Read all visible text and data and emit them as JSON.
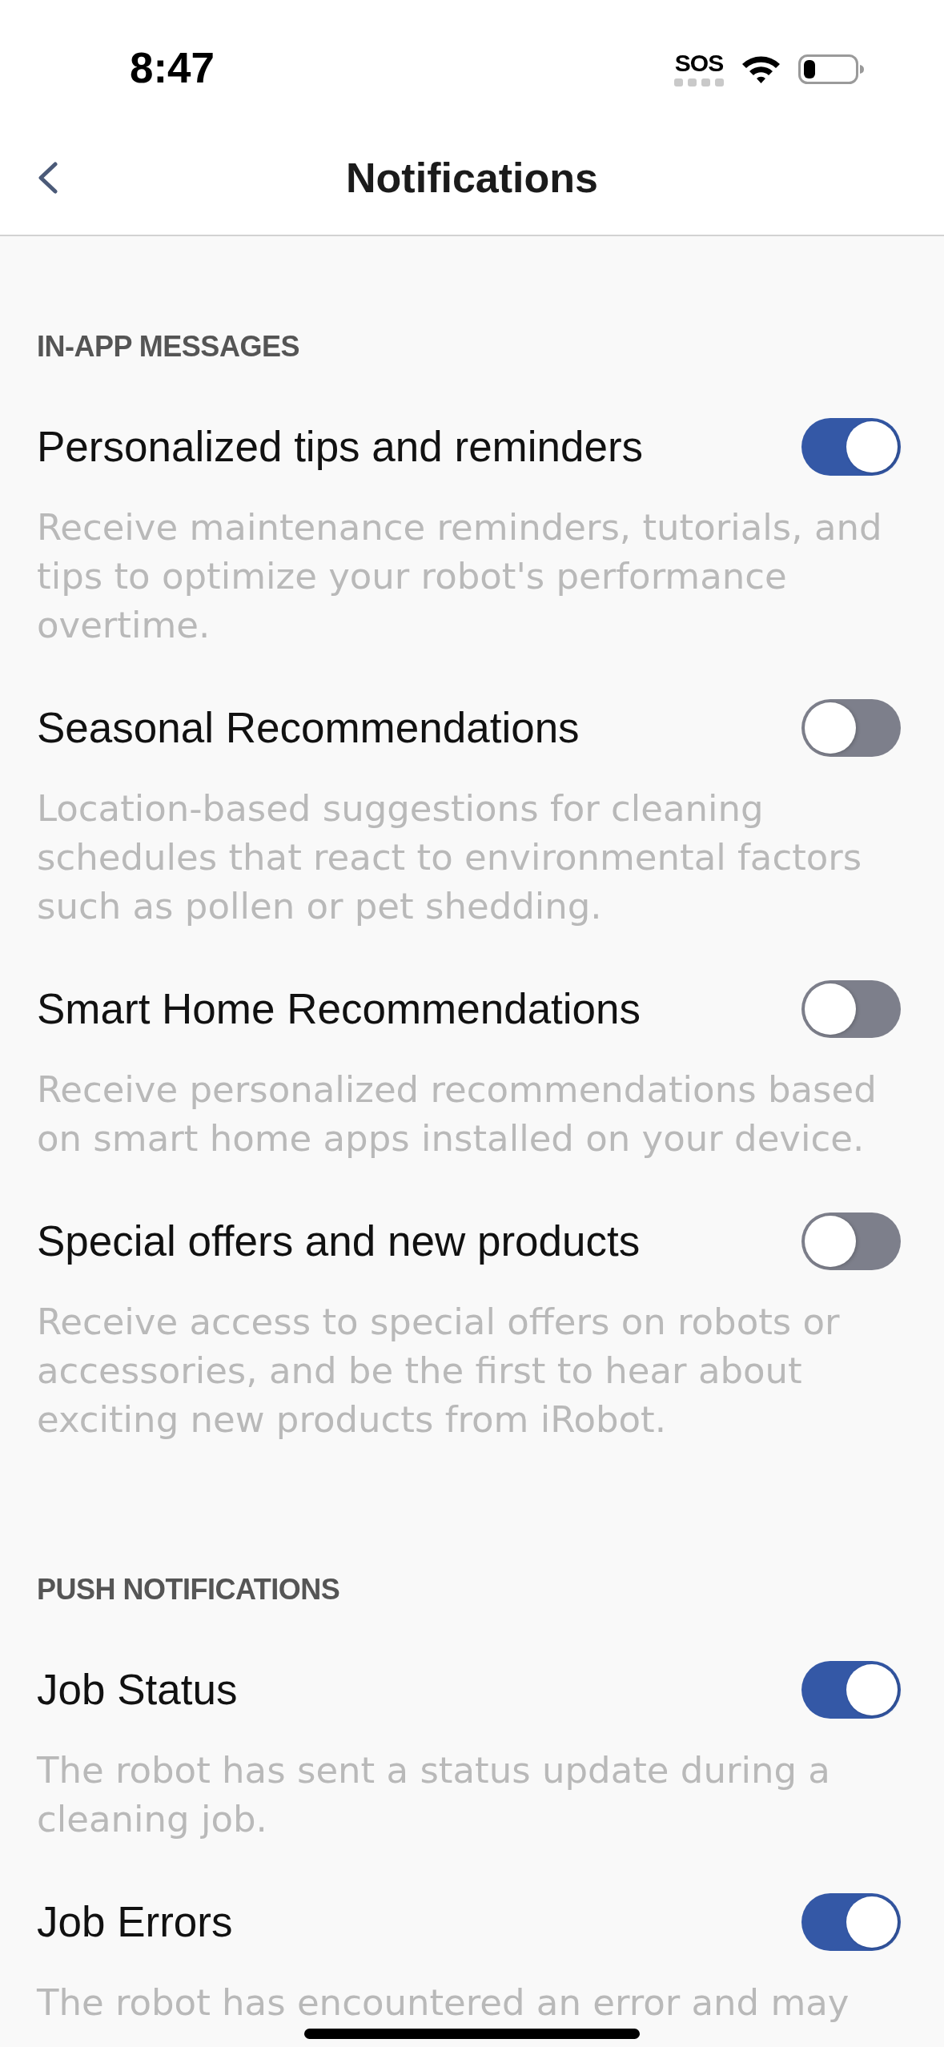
{
  "status_bar": {
    "time": "8:47",
    "carrier": "SOS"
  },
  "nav": {
    "title": "Notifications"
  },
  "sections": [
    {
      "heading": "IN-APP MESSAGES",
      "items": [
        {
          "title": "Personalized tips and reminders",
          "description": "Receive maintenance reminders, tutorials, and tips to optimize your robot's performance overtime.",
          "on": true
        },
        {
          "title": "Seasonal Recommendations",
          "description": "Location-based suggestions for cleaning schedules that react to environmental factors such as pollen or pet shedding.",
          "on": false
        },
        {
          "title": "Smart Home Recommendations",
          "description": "Receive personalized recommendations based on smart home apps installed on your device.",
          "on": false
        },
        {
          "title": "Special offers and new products",
          "description": "Receive access to special offers on robots or accessories, and be the first to hear about exciting new products from iRobot.",
          "on": false
        }
      ]
    },
    {
      "heading": "PUSH NOTIFICATIONS",
      "items": [
        {
          "title": "Job Status",
          "description": "The robot has sent a status update during a cleaning job.",
          "on": true
        },
        {
          "title": "Job Errors",
          "description": "The robot has encountered an error and may",
          "on": true
        }
      ]
    }
  ]
}
